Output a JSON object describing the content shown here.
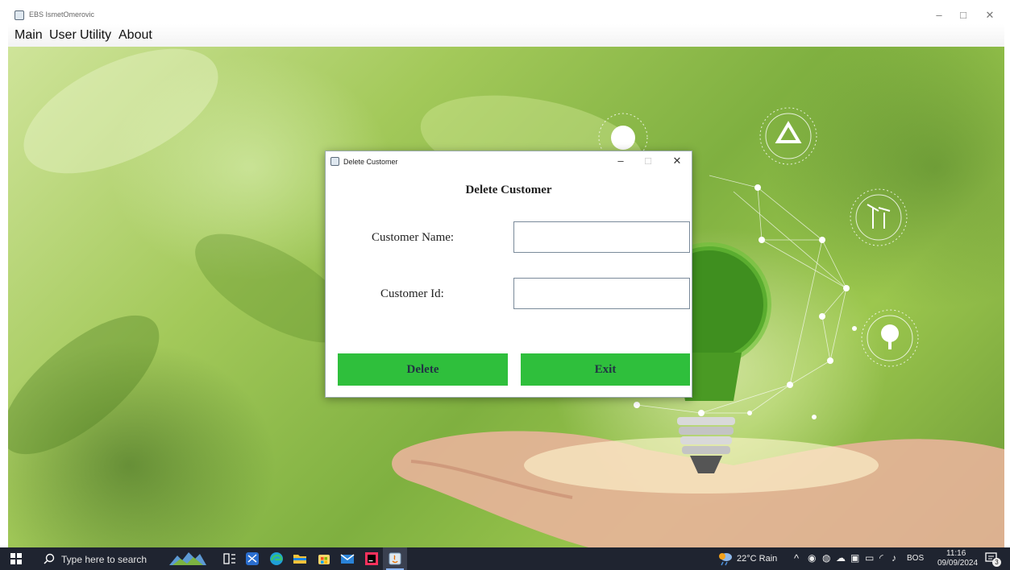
{
  "window": {
    "title": "EBS IsmetOmerovic",
    "controls": {
      "minimize": "–",
      "maximize": "□",
      "close": "✕"
    }
  },
  "menubar": {
    "items": [
      {
        "label": "Main"
      },
      {
        "label": "User"
      },
      {
        "label": "Utility"
      },
      {
        "label": "About"
      }
    ]
  },
  "dialog": {
    "title": "Delete Customer",
    "controls": {
      "minimize": "–",
      "maximize": "□",
      "close": "✕"
    },
    "heading": "Delete Customer",
    "fields": {
      "customer_name": {
        "label": "Customer Name:",
        "value": ""
      },
      "customer_id": {
        "label": "Customer Id:",
        "value": ""
      }
    },
    "buttons": {
      "delete": "Delete",
      "exit": "Exit"
    },
    "button_color": "#2fbf3c"
  },
  "taskbar": {
    "search_placeholder": "Type here to search",
    "weather": "22°C  Rain",
    "language": "BOS",
    "time": "11:16",
    "date": "09/09/2024",
    "notification_count": "3",
    "pinned_icons": [
      "task-view-icon",
      "snipping-tool-icon",
      "edge-icon",
      "file-explorer-icon",
      "microsoft-store-icon",
      "mail-icon",
      "intellij-icon",
      "java-icon"
    ]
  }
}
